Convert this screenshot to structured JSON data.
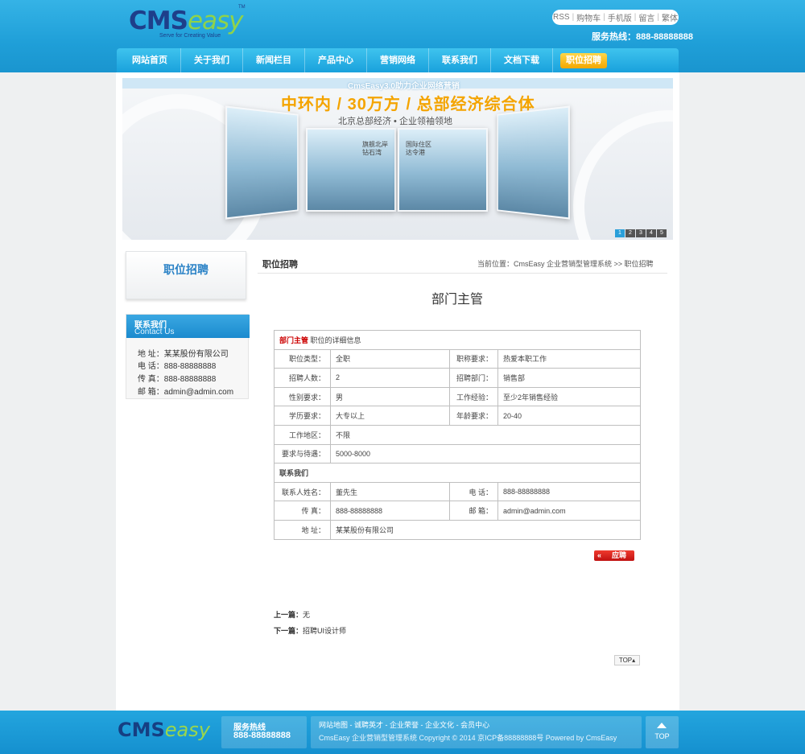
{
  "header": {
    "logo": {
      "cms": "CMS",
      "easy": "easy",
      "tm": "TM",
      "slogan": "Serve for Creating Value"
    },
    "toplinks": [
      "RSS",
      "购物车",
      "手机版",
      "留言",
      "繁体"
    ],
    "hotline": "服务热线：888-88888888"
  },
  "nav": {
    "items": [
      "网站首页",
      "关于我们",
      "新闻栏目",
      "产品中心",
      "营销网络",
      "联系我们",
      "文档下载",
      "职位招聘"
    ],
    "active_index": 7
  },
  "banner": {
    "top_text": "CmsEasy3.0助力企业网络营销",
    "headline": "中环内 / 30万方 / 总部经济综合体",
    "sub": "北京总部经济 • 企业领袖领地",
    "panel1_label": "旗舰北岸\n钻石湾",
    "panel2_label": "国际住区\n达令港",
    "dots": [
      "1",
      "2",
      "3",
      "4",
      "5"
    ],
    "active_dot": 0
  },
  "sidebar": {
    "title": "职位招聘",
    "contact": {
      "heading_cn": "联系我们",
      "heading_en": "Contact Us",
      "lines": [
        "地 址：某某股份有限公司",
        "电 话：888-88888888",
        "传 真：888-88888888",
        "邮 箱：admin@admin.com"
      ]
    }
  },
  "main": {
    "title": "职位招聘",
    "breadcrumb": "当前位置：CmsEasy 企业营销型管理系统  >> 职位招聘",
    "job_title": "部门主管",
    "table": {
      "header_red": "部门主管",
      "header_rest": " 职位的详细信息",
      "rows": [
        {
          "k1": "职位类型：",
          "v1": "全职",
          "k2": "职称要求：",
          "v2": "热爱本职工作"
        },
        {
          "k1": "招聘人数：",
          "v1": "2",
          "k2": "招聘部门：",
          "v2": "销售部"
        },
        {
          "k1": "性别要求：",
          "v1": "男",
          "k2": "工作经验：",
          "v2": "至少2年销售经验"
        },
        {
          "k1": "学历要求：",
          "v1": "大专以上",
          "k2": "年龄要求：",
          "v2": "20-40"
        }
      ],
      "work_area_k": "工作地区：",
      "work_area_v": "不限",
      "salary_k": "要求与待遇：",
      "salary_v": "5000-8000",
      "contact_heading": "联系我们",
      "contact_rows": [
        {
          "k1": "联系人姓名：",
          "v1": "董先生",
          "k2": "电 话：",
          "v2": "888-88888888"
        },
        {
          "k1": "传 真：",
          "v1": "888-88888888",
          "k2": "邮 箱：",
          "v2": "admin@admin.com"
        }
      ],
      "address_k": "地 址：",
      "address_v": "某某股份有限公司"
    },
    "apply_arrow": "«",
    "apply_label": "应聘",
    "prev_label": "上一篇：",
    "prev_value": "无",
    "next_label": "下一篇：",
    "next_value": "招聘UI设计师",
    "top_label": "TOP▴"
  },
  "footer": {
    "logo_cms": "CMS",
    "logo_easy": "easy",
    "hotline_label": "服务热线",
    "hotline_value": "888-88888888",
    "links_line": [
      "网站地图",
      "诚聘英才",
      "企业荣誉",
      "企业文化",
      "会员中心"
    ],
    "copyright": "CmsEasy 企业营销型管理系统 Copyright © 2014 京ICP备88888888号 Powered by CmsEasy",
    "top_label": "TOP"
  }
}
